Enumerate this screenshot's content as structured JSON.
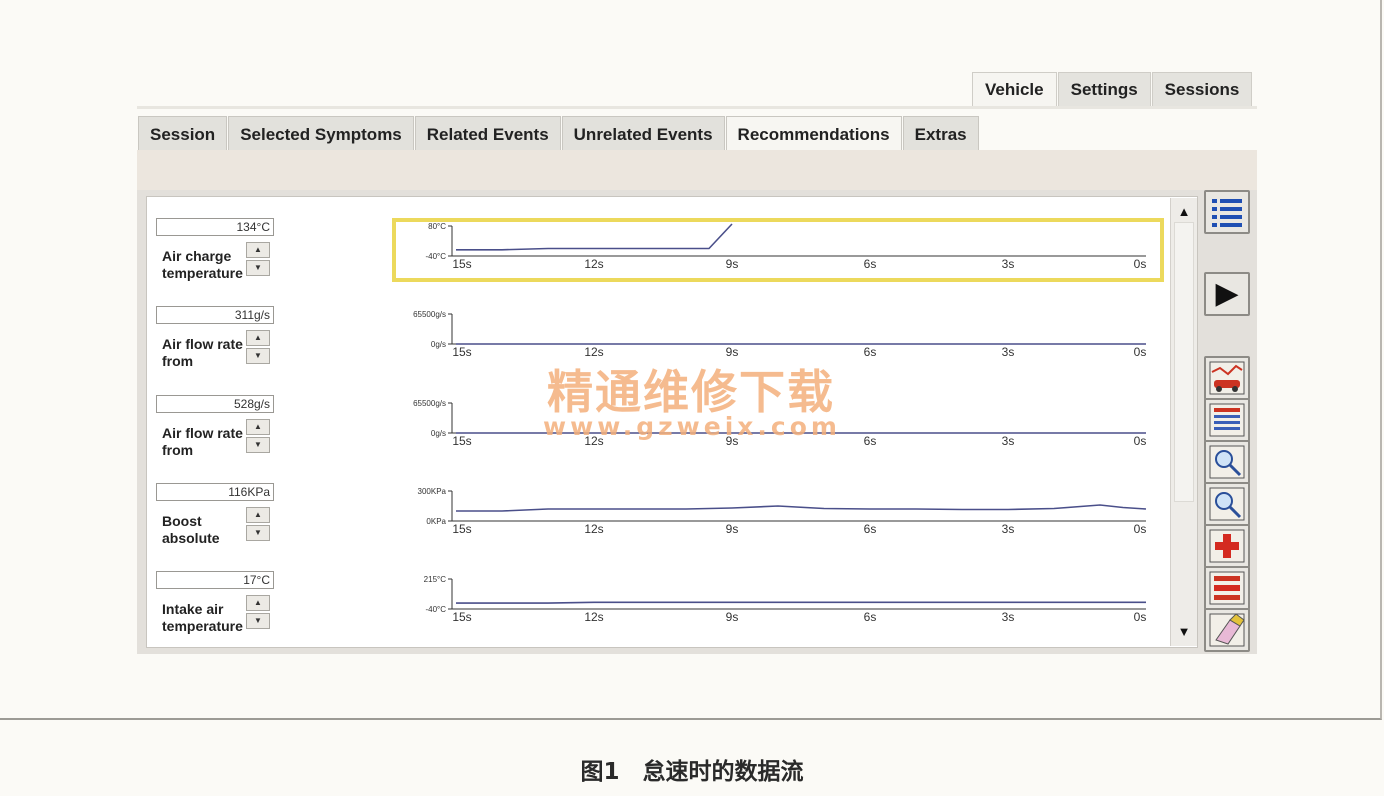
{
  "top_tabs": [
    "Vehicle",
    "Settings",
    "Sessions"
  ],
  "sub_tabs": [
    "Session",
    "Selected Symptoms",
    "Related Events",
    "Unrelated Events",
    "Recommendations",
    "Extras"
  ],
  "time_axis": [
    "15s",
    "12s",
    "9s",
    "6s",
    "3s",
    "0s"
  ],
  "sensors": [
    {
      "value": "134°C",
      "name": "Air charge temperature",
      "y_max": "80°C",
      "y_min": "-40°C"
    },
    {
      "value": "311g/s",
      "name": "Air flow rate from",
      "y_max": "65500g/s",
      "y_min": "0g/s"
    },
    {
      "value": "528g/s",
      "name": "Air flow rate from",
      "y_max": "65500g/s",
      "y_min": "0g/s"
    },
    {
      "value": "116KPa",
      "name": "Boost absolute",
      "y_max": "300KPa",
      "y_min": "0KPa"
    },
    {
      "value": "17°C",
      "name": "Intake air temperature",
      "y_max": "215°C",
      "y_min": "-40°C"
    }
  ],
  "spinner": {
    "up": "▲",
    "down": "▼"
  },
  "scrollbar": {
    "up": "▲",
    "down": "▼"
  },
  "toolbar": {
    "list": "list-icon",
    "play": "▶",
    "tools": [
      "car-graph-icon",
      "data-table-icon",
      "zoom-in-icon",
      "zoom-out-icon",
      "add-graph-icon",
      "remove-graph-icon",
      "erase-icon"
    ]
  },
  "watermark": {
    "cn": "精通维修下载",
    "url": "www.gzweix.com"
  },
  "caption": "图1　怠速时的数据流",
  "chart_data": [
    {
      "type": "line",
      "title": "Air charge temperature",
      "x": [
        15,
        14,
        13,
        12,
        11,
        10,
        9.5,
        9
      ],
      "y": [
        -15,
        -15,
        -10,
        -10,
        -10,
        -10,
        -10,
        95
      ],
      "ylim": [
        -40,
        80
      ],
      "xlim": [
        15,
        0
      ]
    },
    {
      "type": "line",
      "title": "Air flow rate from",
      "x": [
        15,
        0
      ],
      "y": [
        0,
        0
      ],
      "ylim": [
        0,
        65500
      ],
      "xlim": [
        15,
        0
      ]
    },
    {
      "type": "line",
      "title": "Air flow rate from",
      "x": [
        15,
        0
      ],
      "y": [
        0,
        0
      ],
      "ylim": [
        0,
        65500
      ],
      "xlim": [
        15,
        0
      ]
    },
    {
      "type": "line",
      "title": "Boost absolute",
      "x": [
        15,
        14,
        13,
        12,
        11,
        10,
        9,
        8,
        7,
        6,
        5,
        4,
        3,
        2,
        1,
        0.5,
        0
      ],
      "y": [
        100,
        100,
        120,
        120,
        120,
        120,
        130,
        150,
        125,
        120,
        120,
        115,
        115,
        125,
        160,
        135,
        120
      ],
      "ylim": [
        0,
        300
      ],
      "xlim": [
        15,
        0
      ]
    },
    {
      "type": "line",
      "title": "Intake air temperature",
      "x": [
        15,
        13,
        12,
        0
      ],
      "y": [
        10,
        10,
        17,
        17
      ],
      "ylim": [
        -40,
        215
      ],
      "xlim": [
        15,
        0
      ]
    }
  ]
}
